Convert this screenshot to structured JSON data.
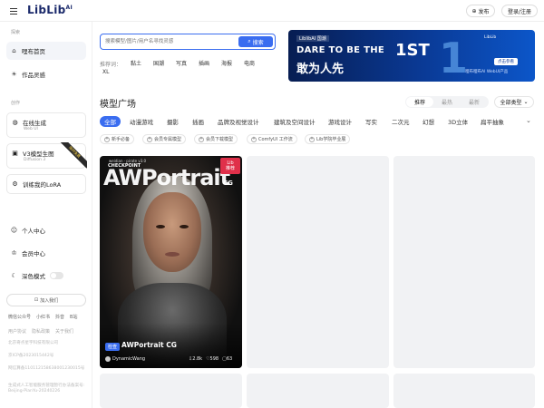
{
  "header": {
    "logo": "LibLib",
    "logo_sup": "AI",
    "publish_label": "发布",
    "login_label": "登录/注册"
  },
  "sidebar": {
    "explore_title": "探索",
    "nav_home": "哩布首页",
    "nav_inspiration": "作品灵感",
    "create_title": "创作",
    "online_gen": "在线生成",
    "online_gen_sub": "Web UI",
    "v3_gen": "V3模型生图",
    "v3_gen_sub": "Diffusion 3",
    "v3_ribbon": "限时免费",
    "train_lora": "训练我的LoRA",
    "personal": "个人中心",
    "member": "会员中心",
    "dark_mode": "深色模式",
    "join_us": "加入我们",
    "links": [
      "微信公众号",
      "小红书",
      "抖音",
      "B站"
    ],
    "links2": [
      "用户协议",
      "隐私政策",
      "关于我们"
    ],
    "company": "北京奇点星宇科技有限公司",
    "icp": "京ICP备2023015442号",
    "police": "网信算备110112158638001230015号",
    "ai_filing": "生成式人工智能服务管理暂行办法备案号: Beijing-PianYu-20240226"
  },
  "search": {
    "placeholder": "搜索模型/图片/用户名寻找灵感",
    "button": "搜索",
    "hot_label": "推荐词：",
    "tags": [
      "黏土",
      "国潮",
      "写真",
      "插画",
      "海报",
      "电商"
    ],
    "tag_xl": "XL"
  },
  "banner": {
    "tag": "LiblibAI 国潮",
    "line1": "DARE TO BE THE",
    "first": "1ST",
    "line2": "敢为人先",
    "big": "1",
    "logo": "LibLib",
    "cta": "点击参看",
    "sub": "哩布哩布AI WebUI产品"
  },
  "gallery": {
    "title": "模型广场",
    "tabs": [
      "推荐",
      "最热",
      "最新"
    ],
    "active_tab": "推荐",
    "type_select": "全部类型",
    "categories": [
      "全部",
      "动漫游戏",
      "摄影",
      "插画",
      "品牌及视觉设计",
      "建筑及空间设计",
      "游戏设计",
      "写实",
      "二次元",
      "幻想",
      "3D立体",
      "扁平抽象"
    ],
    "filters": [
      "新手必备",
      "会员专属模型",
      "会员下载模型",
      "ComfyUI 工作流",
      "Lib学院毕业展"
    ]
  },
  "hero": {
    "brand_small": "weidian · pirate v3.0",
    "checkpoint": "CHECKPOINT",
    "art_title": "AWPortrait",
    "cg": "CG",
    "lib_badge_1": "Lib",
    "lib_badge_2": "推荐",
    "model_type": "检查",
    "model_name": "AWPortrait CG",
    "author": "DynamicWang",
    "downloads": "2.8k",
    "likes": "598",
    "comments": "63"
  }
}
